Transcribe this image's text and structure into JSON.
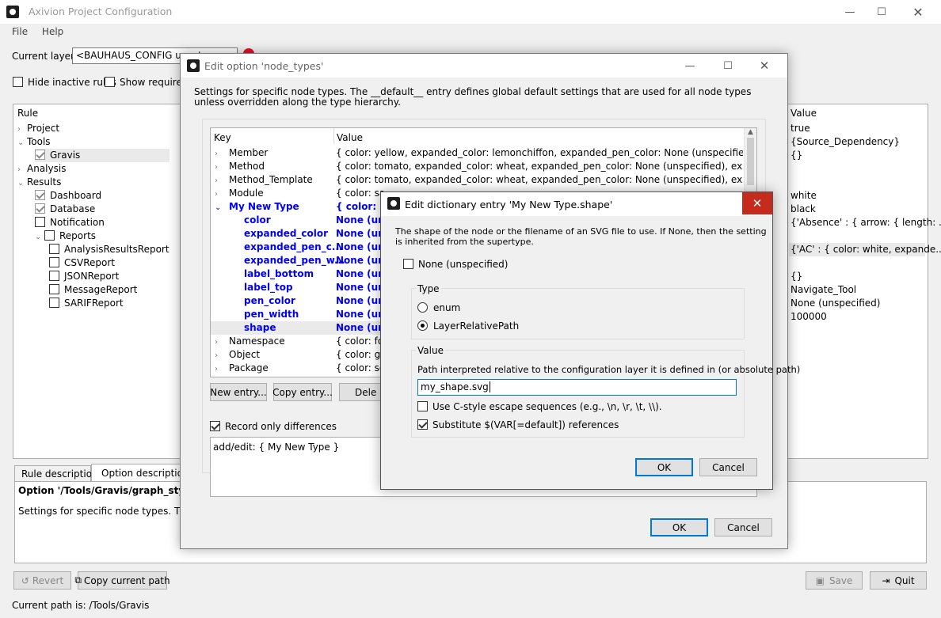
{
  "app": {
    "title": "Axivion Project Configuration",
    "menu": [
      "File",
      "Help"
    ],
    "current_layer_label": "Current layer:",
    "current_layer_value": "<BAUHAUS_CONFIG unset",
    "hide_inactive": "Hide inactive rules",
    "show_requirements": "Show requireme",
    "rule_header": "Rule",
    "value_header": "Value",
    "tree": [
      {
        "label": "Project",
        "level": 0,
        "expander": "›",
        "checkbox": false
      },
      {
        "label": "Tools",
        "level": 0,
        "expander": "⌄",
        "checkbox": false
      },
      {
        "label": "Gravis",
        "level": 1,
        "checkbox": "checked-grey",
        "selected": true
      },
      {
        "label": "Analysis",
        "level": 0,
        "expander": "›"
      },
      {
        "label": "Results",
        "level": 0,
        "expander": "⌄"
      },
      {
        "label": "Dashboard",
        "level": 1,
        "checkbox": "checked-grey"
      },
      {
        "label": "Database",
        "level": 1,
        "checkbox": "checked-grey"
      },
      {
        "label": "Notification",
        "level": 1,
        "checkbox": "unchecked"
      },
      {
        "label": "Reports",
        "level": 1,
        "expander": "⌄",
        "checkbox": "unchecked"
      },
      {
        "label": "AnalysisResultsReport",
        "level": 2,
        "checkbox": "unchecked"
      },
      {
        "label": "CSVReport",
        "level": 2,
        "checkbox": "unchecked"
      },
      {
        "label": "JSONReport",
        "level": 2,
        "checkbox": "unchecked"
      },
      {
        "label": "MessageReport",
        "level": 2,
        "checkbox": "unchecked"
      },
      {
        "label": "SARIFReport",
        "level": 2,
        "checkbox": "unchecked"
      }
    ],
    "values": [
      {
        "text": "true"
      },
      {
        "text": "{Source_Dependency}"
      },
      {
        "text": "{}"
      },
      {
        "text": "white"
      },
      {
        "text": "black"
      },
      {
        "text": "{'Absence' : { arrow: { length: ..."
      },
      {
        "text": "{'AC' : { color: white, expande..."
      },
      {
        "text": "{}"
      },
      {
        "text": "Navigate_Tool"
      },
      {
        "text": "None (unspecified)"
      },
      {
        "text": "100000"
      }
    ],
    "desc_tabs": [
      "Rule description",
      "Option description"
    ],
    "desc_title": "Option '/Tools/Gravis/graph_style.n",
    "desc_text": "Settings for specific node types. The __de",
    "revert": "Revert",
    "copy_path": "Copy current path",
    "save": "Save",
    "quit": "Quit",
    "status": "Current path is: /Tools/Gravis"
  },
  "edit_option": {
    "title": "Edit option 'node_types'",
    "description": "Settings for specific node types. The __default__ entry defines global default settings that are used for all node types unless overridden along the type hierarchy.",
    "key_header": "Key",
    "value_header": "Value",
    "rows": [
      {
        "key": "Member",
        "value": "{ color: yellow, expanded_color: lemonchiffon, expanded_pen_color: None (unspecified), expan...",
        "type": "parent"
      },
      {
        "key": "Method",
        "value": "{ color: tomato, expanded_color: wheat, expanded_pen_color: None (unspecified), expanded_p...",
        "type": "parent"
      },
      {
        "key": "Method_Template",
        "value": "{ color: tomato, expanded_color: wheat, expanded_pen_color: None (unspecified), expanded_p...",
        "type": "parent"
      },
      {
        "key": "Module",
        "value": "{ color: sa",
        "type": "parent"
      },
      {
        "key": "My New Type",
        "value": "{ color: No",
        "type": "open"
      },
      {
        "key": "color",
        "value": "None (uns",
        "type": "child"
      },
      {
        "key": "expanded_color",
        "value": "None (uns",
        "type": "child"
      },
      {
        "key": "expanded_pen_c...",
        "value": "None (uns",
        "type": "child"
      },
      {
        "key": "expanded_pen_w...",
        "value": "None (uns",
        "type": "child"
      },
      {
        "key": "label_bottom",
        "value": "None (uns",
        "type": "child"
      },
      {
        "key": "label_top",
        "value": "None (uns",
        "type": "child"
      },
      {
        "key": "pen_color",
        "value": "None (uns",
        "type": "child"
      },
      {
        "key": "pen_width",
        "value": "None (uns",
        "type": "child"
      },
      {
        "key": "shape",
        "value": "None (uns",
        "type": "child-selected"
      },
      {
        "key": "Namespace",
        "value": "{ color: for",
        "type": "parent"
      },
      {
        "key": "Object",
        "value": "{ color: gol",
        "type": "parent"
      },
      {
        "key": "Package",
        "value": "{ color: sea",
        "type": "parent"
      }
    ],
    "new_entry": "New entry...",
    "copy_entry": "Copy entry...",
    "delete": "Dele",
    "record_only": "Record only differences",
    "diff_text": "add/edit: { My New Type }",
    "ok": "OK",
    "cancel": "Cancel"
  },
  "edit_dict": {
    "title": "Edit dictionary entry 'My New Type.shape'",
    "description": "The shape of the node or the filename of an SVG file to use. If None, then the setting is inherited from the supertype.",
    "none_label": "None (unspecified)",
    "type_label": "Type",
    "type_options": [
      "enum",
      "LayerRelativePath"
    ],
    "value_label": "Value",
    "path_hint": "Path interpreted relative to the configuration layer it is defined in (or absolute path)",
    "path_value": "my_shape.svg",
    "escape_label": "Use C-style escape sequences (e.g., \\n, \\r, \\t, \\\\).",
    "substitute_label": "Substitute $(VAR[=default]) references",
    "ok": "OK",
    "cancel": "Cancel"
  }
}
